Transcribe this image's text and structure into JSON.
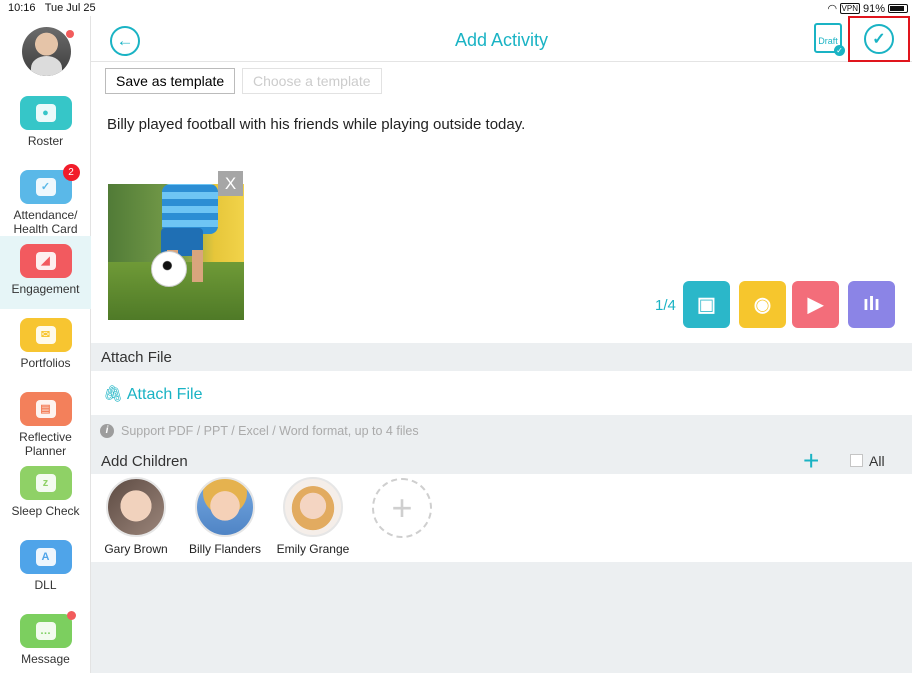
{
  "status_bar": {
    "time": "10:16",
    "date": "Tue Jul 25",
    "vpn": "VPN",
    "battery": "91%"
  },
  "header": {
    "title": "Add Activity",
    "draft_label": "Draft",
    "back_icon": "back-arrow-icon",
    "done_icon": "check-circle-icon"
  },
  "sidebar": {
    "items": [
      {
        "label": "Roster",
        "color": "#36c6c8",
        "icon": "roster-icon",
        "badge": ""
      },
      {
        "label": "Attendance/ Health Card",
        "color": "#5ab8e8",
        "icon": "calendar-check-icon",
        "badge": "2"
      },
      {
        "label": "Engagement",
        "color": "#f25a5f",
        "icon": "engagement-icon",
        "badge": ""
      },
      {
        "label": "Portfolios",
        "color": "#f7c531",
        "icon": "portfolio-icon",
        "badge": ""
      },
      {
        "label": "Reflective Planner",
        "color": "#f3805b",
        "icon": "planner-icon",
        "badge": ""
      },
      {
        "label": "Sleep Check",
        "color": "#8fd166",
        "icon": "sleep-icon",
        "badge": ""
      },
      {
        "label": "DLL",
        "color": "#4fa4e9",
        "icon": "dll-icon",
        "badge": ""
      },
      {
        "label": "Message",
        "color": "#7ccf5f",
        "icon": "message-icon",
        "badge": ""
      }
    ]
  },
  "template": {
    "save_label": "Save as template",
    "choose_label": "Choose a template"
  },
  "note": {
    "text": "Billy played football with his friends while playing outside today."
  },
  "media": {
    "photo_close": "X",
    "counter": "1/4",
    "buttons": [
      {
        "name": "image",
        "color": "#2bb7c9"
      },
      {
        "name": "camera",
        "color": "#f6c62d"
      },
      {
        "name": "video",
        "color": "#f36d7a"
      },
      {
        "name": "audio",
        "color": "#8b84e6"
      }
    ]
  },
  "attach": {
    "section_label": "Attach File",
    "link_label": "Attach File",
    "info": "Support PDF / PPT / Excel / Word format, up to 4 files"
  },
  "children": {
    "section_label": "Add Children",
    "all_label": "All",
    "list": [
      {
        "name": "Gary Brown"
      },
      {
        "name": "Billy Flanders"
      },
      {
        "name": "Emily Grange"
      }
    ]
  },
  "colors": {
    "accent": "#1ab3c4",
    "highlight": "#e0151d",
    "background": "#eceff1"
  }
}
